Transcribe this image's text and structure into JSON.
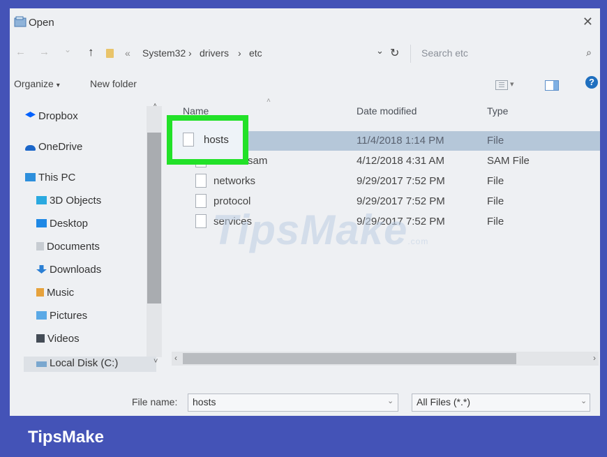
{
  "window": {
    "title": "Open",
    "close_glyph": "✕"
  },
  "address": {
    "back_glyph": "←",
    "forward_glyph": "→",
    "recent_glyph": "⌄",
    "up_glyph": "↑",
    "sep_glyph": "«",
    "crumbs": [
      "System32",
      "drivers",
      "etc"
    ],
    "crumb_sep": "›",
    "dropdown_glyph": "⌄",
    "refresh_glyph": "↻"
  },
  "search": {
    "placeholder": "Search etc",
    "icon_glyph": "⌕"
  },
  "toolbar": {
    "organize_label": "Organize",
    "organize_caret": "▾",
    "new_folder_label": "New folder",
    "help_glyph": "?"
  },
  "nav_pane": {
    "items": [
      {
        "label": "Dropbox",
        "icon": "dropbox-icon",
        "color": "#0061fe"
      },
      {
        "label": "OneDrive",
        "icon": "onedrive-icon",
        "color": "#1b66c9"
      },
      {
        "label": "This PC",
        "icon": "this-pc-icon",
        "color": "#2d8fdc"
      },
      {
        "label": "3D Objects",
        "icon": "3d-objects-icon",
        "color": "#2aa9e0"
      },
      {
        "label": "Desktop",
        "icon": "desktop-icon",
        "color": "#1e88e5"
      },
      {
        "label": "Documents",
        "icon": "documents-icon",
        "color": "#9aa3ad"
      },
      {
        "label": "Downloads",
        "icon": "downloads-icon",
        "color": "#2b7fd4"
      },
      {
        "label": "Music",
        "icon": "music-icon",
        "color": "#e6a23c"
      },
      {
        "label": "Pictures",
        "icon": "pictures-icon",
        "color": "#5aa9e6"
      },
      {
        "label": "Videos",
        "icon": "videos-icon",
        "color": "#444c56"
      },
      {
        "label": "Local Disk (C:)",
        "icon": "local-disk-icon",
        "color": "#7aa7cf"
      }
    ],
    "scroll_up_glyph": "˄",
    "scroll_down_glyph": "˅",
    "disk_chevron_glyph": "˅"
  },
  "columns": {
    "name": "Name",
    "date_modified": "Date modified",
    "type": "Type",
    "sort_glyph": "˄"
  },
  "files": [
    {
      "name": "hosts",
      "date": "11/4/2018 1:14 PM",
      "type": "File",
      "selected": true
    },
    {
      "name": "lmhosts.sam",
      "name_visible": "sam",
      "date": "4/12/2018 4:31 AM",
      "type": "SAM File"
    },
    {
      "name": "networks",
      "date": "9/29/2017 7:52 PM",
      "type": "File"
    },
    {
      "name": "protocol",
      "date": "9/29/2017 7:52 PM",
      "type": "File"
    },
    {
      "name": "services",
      "date": "9/29/2017 7:52 PM",
      "type": "File"
    }
  ],
  "hscroll": {
    "left_glyph": "‹",
    "right_glyph": "›"
  },
  "footer": {
    "filename_label": "File name:",
    "filename_value": "hosts",
    "filename_chevron": "⌄",
    "filetype_value": "All Files  (*.*)",
    "filetype_chevron": "⌄"
  },
  "watermark": {
    "text": "TipsMake",
    "suffix": ".com"
  },
  "banner": {
    "brand": "TipsMake"
  },
  "colors": {
    "banner": "#4453b7",
    "highlight": "#22e128",
    "selection": "#b5c7d9"
  }
}
